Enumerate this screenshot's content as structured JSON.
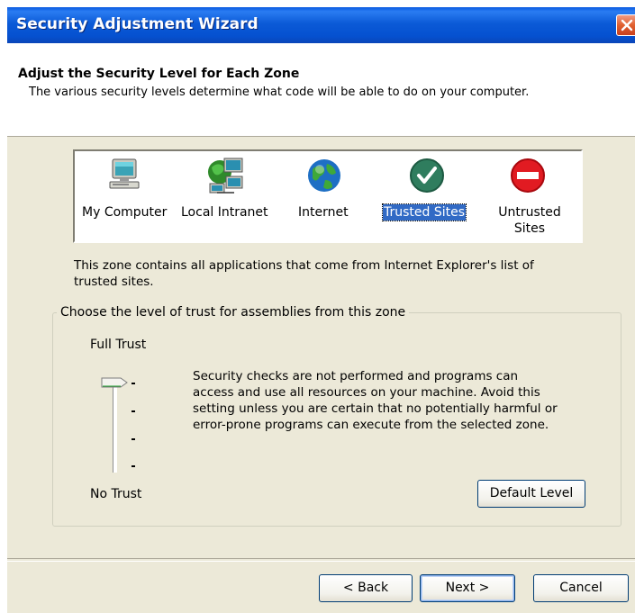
{
  "window": {
    "title": "Security Adjustment Wizard"
  },
  "header": {
    "title": "Adjust the Security Level for Each Zone",
    "description": "The various security levels determine what code will be able to do on your computer."
  },
  "zones": [
    {
      "label": "My Computer",
      "icon": "computer-icon",
      "selected": false
    },
    {
      "label": "Local Intranet",
      "icon": "network-icon",
      "selected": false
    },
    {
      "label": "Internet",
      "icon": "globe-icon",
      "selected": false
    },
    {
      "label": "Trusted Sites",
      "icon": "checkmark-icon",
      "selected": true
    },
    {
      "label": "Untrusted Sites",
      "icon": "no-entry-icon",
      "selected": false
    }
  ],
  "zone_description": "This zone contains all applications that come from Internet Explorer's list of trusted sites.",
  "trust_group": {
    "legend": "Choose the level of trust for assemblies from this zone",
    "top_label": "Full Trust",
    "bottom_label": "No Trust",
    "slider_level": "Full Trust",
    "level_description": "Security checks are not performed and programs can access and use all resources on your machine.  Avoid this setting unless you are certain that no potentially harmful or error-prone programs can execute from the selected zone.",
    "default_button": "Default Level"
  },
  "footer": {
    "back": "< Back",
    "next": "Next >",
    "cancel": "Cancel"
  },
  "colors": {
    "titlebar": "#0a5be0",
    "selection": "#316ac5",
    "dialog_bg": "#ece9d8"
  }
}
